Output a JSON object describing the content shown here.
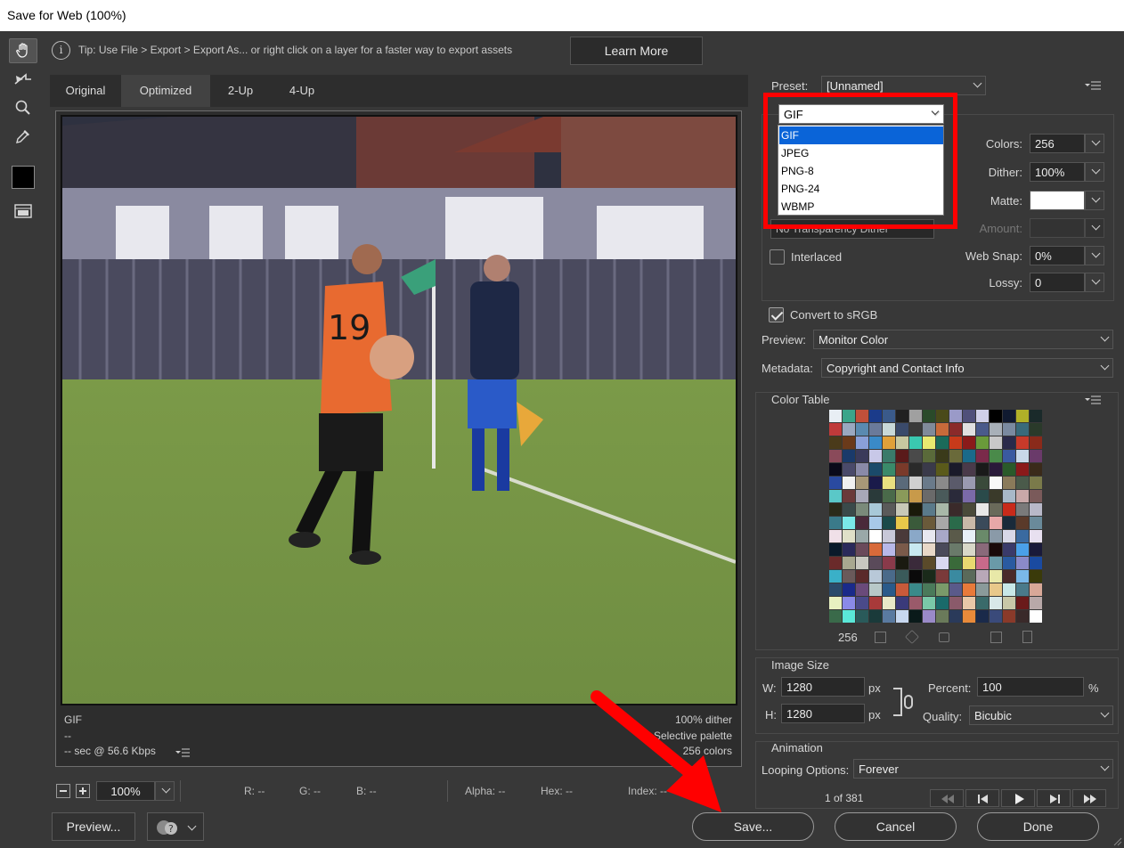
{
  "window": {
    "title": "Save for Web (100%)"
  },
  "tip": {
    "text": "Tip: Use File > Export > Export As...  or right click on a layer for a faster way to export assets",
    "learn_more": "Learn More"
  },
  "tabs": [
    "Original",
    "Optimized",
    "2-Up",
    "4-Up"
  ],
  "preview": {
    "format": "GIF",
    "size": "--",
    "time": "-- sec @ 56.6 Kbps",
    "dither": "100% dither",
    "palette": "Selective palette",
    "colors": "256 colors",
    "jersey_number": "19"
  },
  "status": {
    "zoom": "100%",
    "r": "R: --",
    "g": "G: --",
    "b": "B: --",
    "alpha": "Alpha: --",
    "hex": "Hex: --",
    "index": "Index: --"
  },
  "buttons": {
    "preview": "Preview...",
    "save": "Save...",
    "cancel": "Cancel",
    "done": "Done"
  },
  "settings": {
    "preset_label": "Preset:",
    "preset_value": "[Unnamed]",
    "format_value": "GIF",
    "format_options": [
      "GIF",
      "JPEG",
      "PNG-8",
      "PNG-24",
      "WBMP"
    ],
    "transparency_dither": "No Transparency Dither",
    "interlaced": "Interlaced",
    "colors_label": "Colors:",
    "colors_value": "256",
    "dither_label": "Dither:",
    "dither_value": "100%",
    "matte_label": "Matte:",
    "amount_label": "Amount:",
    "websnap_label": "Web Snap:",
    "websnap_value": "0%",
    "lossy_label": "Lossy:",
    "lossy_value": "0",
    "convert_srgb": "Convert to sRGB",
    "preview_label": "Preview:",
    "preview_value": "Monitor Color",
    "metadata_label": "Metadata:",
    "metadata_value": "Copyright and Contact Info"
  },
  "color_table": {
    "title": "Color Table",
    "count": "256",
    "swatches": [
      "#e8eef4",
      "#3aa58a",
      "#c0503a",
      "#1b3b8a",
      "#3a5a8a",
      "#202020",
      "#a0a0a0",
      "#2a4a2a",
      "#4a4a1a",
      "#9a9ac8",
      "#50507a",
      "#d0d0e8",
      "#000000",
      "#101a30",
      "#b0b028",
      "#1a2a2a",
      "#c03a3a",
      "#9aa8c0",
      "#5a8ab0",
      "#6a7a9a",
      "#c8d8d8",
      "#3a4a6a",
      "#3a3a3a",
      "#808a9a",
      "#c86a3a",
      "#8a2a2a",
      "#e0e0e0",
      "#4a5a8a",
      "#a8b0b8",
      "#7a8aa0",
      "#3a6a7a",
      "#2a3a2a",
      "#4a3a1a",
      "#6a3a1a",
      "#8aa0d8",
      "#3a8ac8",
      "#e0a03a",
      "#c8c8a0",
      "#3ac8b0",
      "#e8e870",
      "#1a6a5a",
      "#c83a1a",
      "#8a1a1a",
      "#6a9a3a",
      "#c8c8c8",
      "#2a2a4a",
      "#c83a2a",
      "#8a2a1a",
      "#8a4a5a",
      "#1a3a6a",
      "#3a3a5a",
      "#c8c8e8",
      "#3a7a6a",
      "#5a1a1a",
      "#4a4a4a",
      "#5a6a3a",
      "#3a3a1a",
      "#6a6a3a",
      "#1a6a8a",
      "#7a2a4a",
      "#4a8a4a",
      "#3a5aa0",
      "#c8d8e8",
      "#6a3a6a",
      "#0a0a1a",
      "#4a4a6a",
      "#8a8aa8",
      "#1a4a6a",
      "#3a8a6a",
      "#7a3a2a",
      "#2a2a2a",
      "#3a3a4a",
      "#5a5a1a",
      "#1a1a2a",
      "#4a3a4a",
      "#1a1a1a",
      "#2a1a3a",
      "#2a5a2a",
      "#8a1a1a",
      "#3a2a1a",
      "#2a4aa0",
      "#f0f0f0",
      "#a89878",
      "#1a1a4a",
      "#e8e080",
      "#5a6a7a",
      "#d0d0d0",
      "#6a7a8a",
      "#8a8a8a",
      "#5a5a6a",
      "#9a9ab0",
      "#3a4a3a",
      "#f8f8f8",
      "#8a7a5a",
      "#4a5a4a",
      "#7a7a4a",
      "#5ac8c8",
      "#6a3a3a",
      "#a8a8b8",
      "#2a3a3a",
      "#4a6a4a",
      "#8a9a5a",
      "#c89a4a",
      "#6a6a6a",
      "#4a5a5a",
      "#2a2a3a",
      "#7a6aa8",
      "#2a4a4a",
      "#3a3a2a",
      "#a8b8c8",
      "#c8a8a8",
      "#7a5a5a",
      "#2a2a1a",
      "#3a4a4a",
      "#7a8a7a",
      "#a8c8d8",
      "#5a5a5a",
      "#c8c8b8",
      "#1a1a0a",
      "#5a7a8a",
      "#a8b8a8",
      "#3a2a2a",
      "#4a4a3a",
      "#e8e8e8",
      "#6a6a5a",
      "#c82a1a",
      "#7a7a7a",
      "#b8b8c8",
      "#3a7a8a",
      "#7ae8e8",
      "#4a2a3a",
      "#a8c8e8",
      "#1a4a4a",
      "#e8c84a",
      "#3a5a3a",
      "#6a5a3a",
      "#a8a8a8",
      "#2a6a4a",
      "#c8b8a8",
      "#3a4a5a",
      "#e8a8a8",
      "#1a2a3a",
      "#5a3a2a",
      "#6a8a9a",
      "#f0e0e8",
      "#e0e0c8",
      "#9aa8a8",
      "#ffffff",
      "#c8c8d8",
      "#4a3a3a",
      "#8aa8c8",
      "#e8e8f0",
      "#a8a8c8",
      "#5a5a4a",
      "#e8f0f8",
      "#6a8a6a",
      "#8a9aa8",
      "#d8d8e8",
      "#3a6aa0",
      "#e8e0f0",
      "#0a1a2a",
      "#2a2a5a",
      "#6a4a5a",
      "#d86a3a",
      "#b8b8e8",
      "#7a5a4a",
      "#c8e8f0",
      "#e8d8c8",
      "#4a4a5a",
      "#6a7a6a",
      "#d8d8c8",
      "#8a6a7a",
      "#1a0a0a",
      "#3a3a6a",
      "#4aa0e8",
      "#1a1a3a",
      "#6a2a2a",
      "#a8a890",
      "#c8c8c0",
      "#5a4a5a",
      "#8a3a4a",
      "#1a1a10",
      "#3a2a3a",
      "#5a4a2a",
      "#d8d8f0",
      "#3a6a3a",
      "#e8d870",
      "#c86a8a",
      "#6a9aa8",
      "#2a5aa0",
      "#8a8ac8",
      "#1a4aa0",
      "#3ab0c8",
      "#6a5a5a",
      "#5a2a2a",
      "#b8c8d8",
      "#4a6a8a",
      "#3a5a5a",
      "#0a0a0a",
      "#1a2a1a",
      "#7a3a3a",
      "#3a8aa0",
      "#5a6a5a",
      "#b8a8b8",
      "#e8e8a8",
      "#4a2a2a",
      "#7ab8e8",
      "#3a3a0a",
      "#2a4a6a",
      "#1a2a8a",
      "#6a4a7a",
      "#b8c8c8",
      "#2a5a8a",
      "#c85a3a",
      "#3a8a8a",
      "#4a7a5a",
      "#7a9a6a",
      "#5a5a8a",
      "#e87a3a",
      "#8a9a9a",
      "#e8c88a",
      "#c8e8e8",
      "#4a7a8a",
      "#d8a898",
      "#e8f0c0",
      "#8a8ae8",
      "#4a4a8a",
      "#a83a3a",
      "#e8e8c8",
      "#3a3a7a",
      "#9a5a6a",
      "#7ac8a8",
      "#1a6a6a",
      "#8a5a6a",
      "#e8c8a8",
      "#3a6a6a",
      "#d8e8e8",
      "#c8c8a8",
      "#6a1a1a",
      "#b8a8a8",
      "#3a6a4a",
      "#5ae8d8",
      "#2a5a5a",
      "#1a3a3a",
      "#5a7aa0",
      "#c8d8f0",
      "#0a1a1a",
      "#9a8ac8",
      "#6a7a5a",
      "#2a3a5a",
      "#e88a3a",
      "#1a2a4a",
      "#3a4a7a",
      "#8a3a2a",
      "#3a2a2a",
      "#ffffff"
    ]
  },
  "image_size": {
    "title": "Image Size",
    "w_label": "W:",
    "w_value": "1280",
    "h_label": "H:",
    "h_value": "1280",
    "unit": "px",
    "percent_label": "Percent:",
    "percent_value": "100",
    "percent_unit": "%",
    "quality_label": "Quality:",
    "quality_value": "Bicubic"
  },
  "animation": {
    "title": "Animation",
    "looping_label": "Looping Options:",
    "looping_value": "Forever",
    "frame": "1 of 381"
  }
}
